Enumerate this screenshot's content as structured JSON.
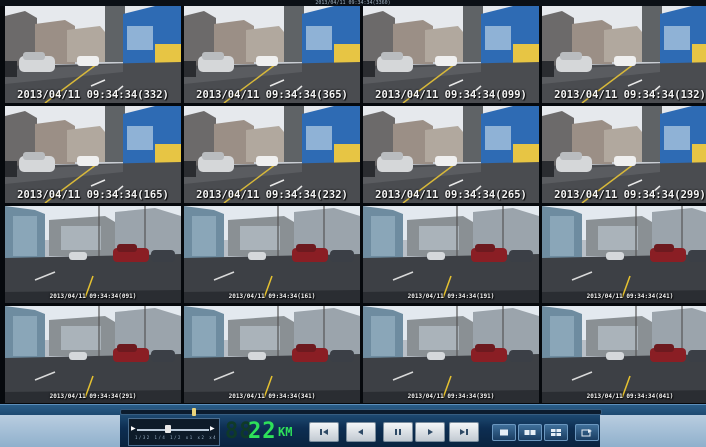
{
  "window": {
    "title": "2013/04/11 09:34:34(3360)"
  },
  "tiles": [
    {
      "timestamp": "2013/04/11 09:34:34(332)"
    },
    {
      "timestamp": "2013/04/11 09:34:34(365)"
    },
    {
      "timestamp": "2013/04/11 09:34:34(099)"
    },
    {
      "timestamp": "2013/04/11 09:34:34(132)"
    },
    {
      "timestamp": "2013/04/11 09:34:34(165)"
    },
    {
      "timestamp": "2013/04/11 09:34:34(232)"
    },
    {
      "timestamp": "2013/04/11 09:34:34(265)"
    },
    {
      "timestamp": "2013/04/11 09:34:34(299)"
    },
    {
      "timestamp": "2013/04/11 09:34:34(091)"
    },
    {
      "timestamp": "2013/04/11 09:34:34(161)"
    },
    {
      "timestamp": "2013/04/11 09:34:34(191)"
    },
    {
      "timestamp": "2013/04/11 09:34:34(241)"
    },
    {
      "timestamp": "2013/04/11 09:34:34(291)"
    },
    {
      "timestamp": "2013/04/11 09:34:34(341)"
    },
    {
      "timestamp": "2013/04/11 09:34:34(391)"
    },
    {
      "timestamp": "2013/04/11 09:34:34(041)"
    }
  ],
  "player": {
    "seek_position": 0.15,
    "mini_slider_ticks": "1/32 1/4 1/2 x1 x2 x4",
    "speed_ghost": "88",
    "speed_value": "22",
    "speed_unit": "KM",
    "buttons": [
      "skip-start-icon",
      "step-back-icon",
      "pause-icon",
      "play-icon",
      "skip-end-icon"
    ],
    "view_buttons": [
      "single-view-icon",
      "dual-view-icon",
      "quad-view-icon",
      "export-icon"
    ],
    "colors": {
      "speed": "#2ee05a",
      "bar": "#0d2e52",
      "timestamp": "#f4f4f4"
    }
  }
}
